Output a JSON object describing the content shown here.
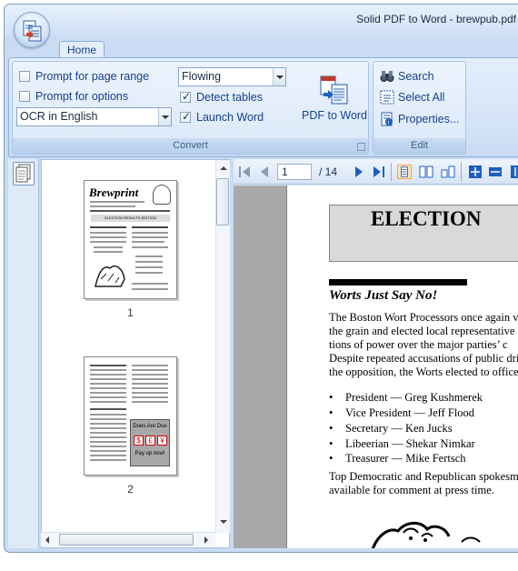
{
  "window": {
    "title": "Solid PDF to Word - brewpub.pdf"
  },
  "ribbon": {
    "tabs": [
      {
        "label": "Home"
      }
    ],
    "convert_group": {
      "label": "Convert",
      "prompt_page_range": {
        "label": "Prompt for page range",
        "checked": false
      },
      "prompt_options": {
        "label": "Prompt for options",
        "checked": false
      },
      "ocr_select": {
        "value": "OCR in English"
      },
      "layout_select": {
        "value": "Flowing"
      },
      "detect_tables": {
        "label": "Detect tables",
        "checked": true
      },
      "launch_word": {
        "label": "Launch Word",
        "checked": true
      },
      "convert_button": {
        "label": "PDF to Word",
        "icon": "pdf-to-word-icon"
      }
    },
    "edit_group": {
      "label": "Edit",
      "search": {
        "label": "Search",
        "icon": "binoculars-icon"
      },
      "select_all": {
        "label": "Select All",
        "icon": "select-all-icon"
      },
      "properties": {
        "label": "Properties...",
        "icon": "properties-icon"
      }
    }
  },
  "thumbnails": [
    {
      "page": "1",
      "masthead": "Brewprint",
      "banner": "ELECTION RESULTS EDITION"
    },
    {
      "page": "2",
      "ad_heading": "Dues Are Due",
      "ad_symbols": [
        "$",
        "£",
        "¥"
      ],
      "ad_footer": "Pay up now!"
    }
  ],
  "viewer": {
    "current_page": "1",
    "page_total": "/ 14",
    "page_content": {
      "headline": "ELECTION",
      "subhead": "Worts Just Say No!",
      "paragraph_lines": [
        "The Boston Wort Processors once again vo",
        "the grain and elected local representative",
        "tions of power over the major parties’ c",
        "Despite repeated accusations of public drin",
        "the opposition, the Worts elected to office:"
      ],
      "officers": [
        "President — Greg Kushmerek",
        "Vice President — Jeff Flood",
        "Secretary — Ken Jucks",
        "Libeerian — Shekar Nimkar",
        "Treasurer — Mike Fertsch"
      ],
      "closing_lines": [
        "Top Democratic and Republican spokesmo",
        "available for comment at press time."
      ]
    }
  },
  "colors": {
    "ribbon_text": "#15428b",
    "ribbon_bg": "#d3e3f7",
    "accent": "#1f5fbf"
  }
}
